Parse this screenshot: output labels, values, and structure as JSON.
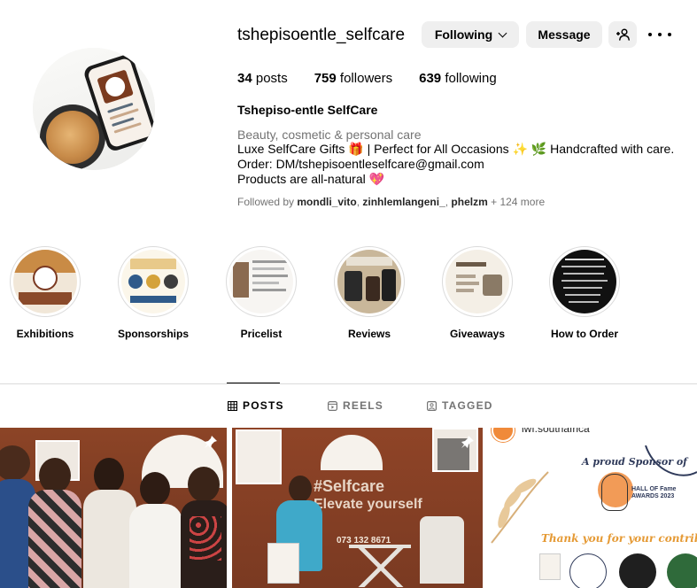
{
  "profile": {
    "username": "tshepisoentle_selfcare",
    "following_label": "Following",
    "message_label": "Message",
    "stats": {
      "posts_count": "34",
      "posts_label": "posts",
      "followers_count": "759",
      "followers_label": "followers",
      "following_count": "639",
      "following_label": "following"
    },
    "full_name": "Tshepiso-entle SelfCare",
    "category": "Beauty, cosmetic & personal care",
    "bio_lines": [
      "Luxe SelfCare Gifts 🎁 | Perfect for All Occasions ✨ 🌿 Handcrafted with care.",
      "Order: DM/tshepisoentleselfcare@gmail.com",
      "Products are all-natural 💖"
    ],
    "followed_by": {
      "prefix": "Followed by",
      "users": [
        "mondli_vito",
        "zinhlemlangeni_",
        "phelzm"
      ],
      "more": "+ 124 more"
    }
  },
  "highlights": [
    {
      "label": "Exhibitions"
    },
    {
      "label": "Sponsorships"
    },
    {
      "label": "Pricelist"
    },
    {
      "label": "Reviews"
    },
    {
      "label": "Giveaways"
    },
    {
      "label": "How to Order"
    }
  ],
  "tabs": [
    {
      "label": "POSTS",
      "icon": "grid-icon",
      "active": true
    },
    {
      "label": "REELS",
      "icon": "reels-icon",
      "active": false
    },
    {
      "label": "TAGGED",
      "icon": "tagged-icon",
      "active": false
    }
  ],
  "posts": {
    "post2": {
      "banner_line1": "#Selfcare",
      "banner_line2": "Elevate yourself",
      "phone": "073 132 8671"
    },
    "post3": {
      "account": "iwf.southafrica",
      "heading": "A proud Sponsor of",
      "award": "HALL OF Fame AWARDS 2023",
      "thanks": "Thank you for your contribution"
    }
  },
  "colors": {
    "button_bg": "#efefef",
    "muted_text": "#737373",
    "divider": "#dbdbdb"
  }
}
